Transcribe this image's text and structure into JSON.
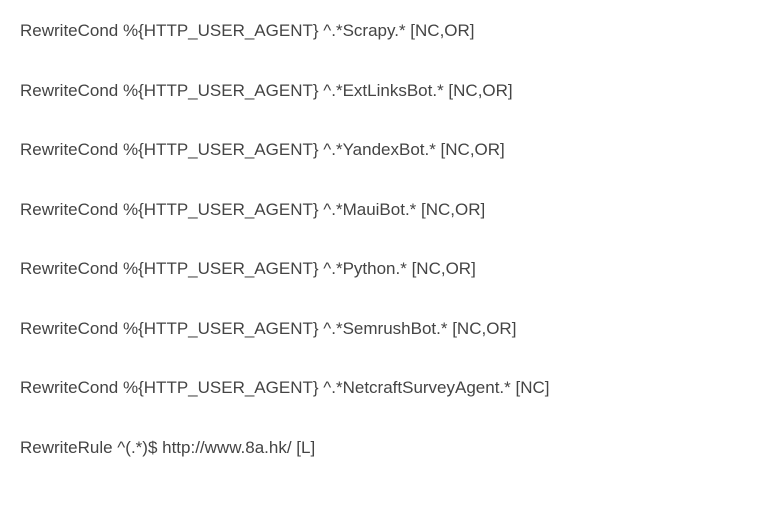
{
  "lines": [
    "RewriteCond %{HTTP_USER_AGENT} ^.*Scrapy.* [NC,OR]",
    "RewriteCond %{HTTP_USER_AGENT} ^.*ExtLinksBot.* [NC,OR]",
    "RewriteCond %{HTTP_USER_AGENT} ^.*YandexBot.* [NC,OR]",
    "RewriteCond %{HTTP_USER_AGENT} ^.*MauiBot.* [NC,OR]",
    "RewriteCond %{HTTP_USER_AGENT} ^.*Python.* [NC,OR]",
    "RewriteCond %{HTTP_USER_AGENT} ^.*SemrushBot.* [NC,OR]",
    "RewriteCond %{HTTP_USER_AGENT} ^.*NetcraftSurveyAgent.* [NC]",
    "RewriteRule ^(.*)$ http://www.8a.hk/ [L]"
  ]
}
